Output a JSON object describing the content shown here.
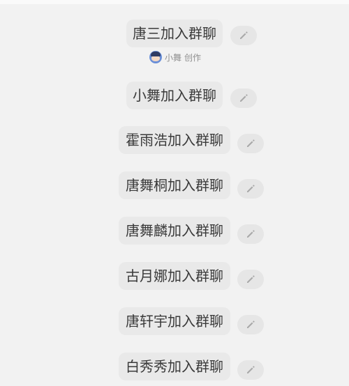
{
  "prompts": [
    {
      "label": "唐三加入群聊"
    },
    {
      "label": "小舞加入群聊"
    },
    {
      "label": "霍雨浩加入群聊"
    },
    {
      "label": "唐舞桐加入群聊"
    },
    {
      "label": "唐舞麟加入群聊"
    },
    {
      "label": "古月娜加入群聊"
    },
    {
      "label": "唐轩宇加入群聊"
    },
    {
      "label": "白秀秀加入群聊"
    }
  ],
  "creator": {
    "name": "小舞",
    "suffix": "创作",
    "avatar_icon": "avatar-icon"
  },
  "icons": {
    "edit": "pencil-icon"
  },
  "colors": {
    "background": "#f2f2f2",
    "pill": "#e9e9e9",
    "text": "#3a3a3a",
    "muted": "#8f8f8f",
    "icon": "#a9a9a9"
  }
}
